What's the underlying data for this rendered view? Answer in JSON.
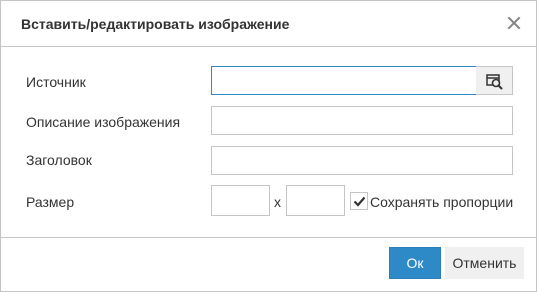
{
  "dialog": {
    "title": "Вставить/редактировать изображение",
    "close_icon": "close-icon"
  },
  "form": {
    "source": {
      "label": "Источник",
      "value": "",
      "browse_icon": "browse-image-icon"
    },
    "description": {
      "label": "Описание изображения",
      "value": ""
    },
    "title_field": {
      "label": "Заголовок",
      "value": ""
    },
    "size": {
      "label": "Размер",
      "width": "",
      "height": "",
      "separator": "x",
      "constrain_label": "Сохранять пропорции",
      "constrain_checked": true
    }
  },
  "buttons": {
    "ok_label": "Ок",
    "cancel_label": "Отменить"
  },
  "colors": {
    "accent": "#2d8ac7",
    "border": "#c5c5c5",
    "button_secondary_bg": "#f0f0f0",
    "text": "#333333"
  }
}
